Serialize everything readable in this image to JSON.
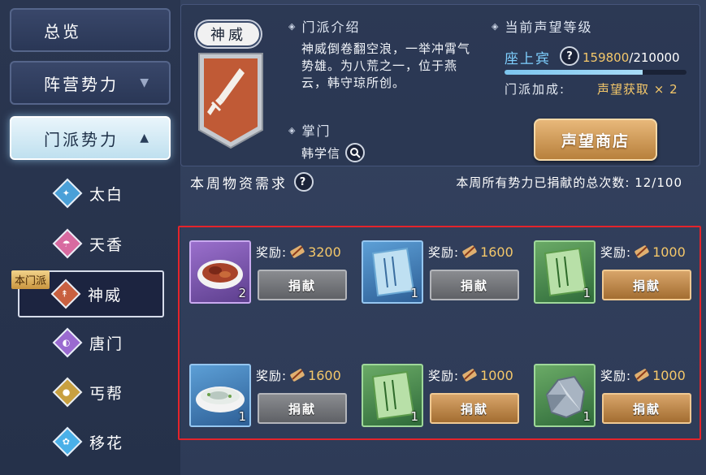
{
  "sidebar": {
    "tabs": [
      {
        "label": "总览",
        "arrow": ""
      },
      {
        "label": "阵营势力",
        "arrow": "▼"
      },
      {
        "label": "门派势力",
        "arrow": "▲"
      }
    ],
    "schools": [
      {
        "label": "太白",
        "icon": "sword-icon",
        "color": "#4aa0d8"
      },
      {
        "label": "天香",
        "icon": "umbrella-icon",
        "color": "#d86aa0"
      },
      {
        "label": "神威",
        "icon": "spear-icon",
        "color": "#c86040"
      },
      {
        "label": "唐门",
        "icon": "fan-icon",
        "color": "#9a6ad0"
      },
      {
        "label": "丐帮",
        "icon": "gourd-icon",
        "color": "#c8a040"
      },
      {
        "label": "移花",
        "icon": "flower-icon",
        "color": "#4ab0e8"
      }
    ],
    "own_tag": "本门派"
  },
  "school": {
    "name": "神威",
    "intro_title": "门派介绍",
    "intro_text": "神威倒卷翻空浪，一举冲霄气势雄。为八荒之一，位于燕云，韩守琼所创。",
    "leader_title": "掌门",
    "leader_name": "韩学信"
  },
  "reputation": {
    "title": "当前声望等级",
    "rank": "座上宾",
    "current": "159800",
    "max": "/210000",
    "progress": 0.761,
    "bonus_label": "门派加成:",
    "bonus_value": "声望获取 × 2",
    "shop_button": "声望商店"
  },
  "weekly": {
    "title": "本周物资需求",
    "count_text": "本周所有势力已捐献的总次数: 12/100"
  },
  "donations": [
    {
      "rarity": "purple",
      "item": "braised-dish-icon",
      "qty": "2",
      "reward_label": "奖励:",
      "reward": "3200",
      "button": "捐献",
      "enabled": false
    },
    {
      "rarity": "blue",
      "item": "scroll-icon",
      "qty": "1",
      "reward_label": "奖励:",
      "reward": "1600",
      "button": "捐献",
      "enabled": false
    },
    {
      "rarity": "green",
      "item": "scroll-icon",
      "qty": "1",
      "reward_label": "奖励:",
      "reward": "1000",
      "button": "捐献",
      "enabled": true
    },
    {
      "rarity": "blue",
      "item": "fish-soup-icon",
      "qty": "1",
      "reward_label": "奖励:",
      "reward": "1600",
      "button": "捐献",
      "enabled": false
    },
    {
      "rarity": "green",
      "item": "scroll-icon",
      "qty": "1",
      "reward_label": "奖励:",
      "reward": "1000",
      "button": "捐献",
      "enabled": true
    },
    {
      "rarity": "green",
      "item": "ore-icon",
      "qty": "1",
      "reward_label": "奖励:",
      "reward": "1000",
      "button": "捐献",
      "enabled": true
    }
  ]
}
